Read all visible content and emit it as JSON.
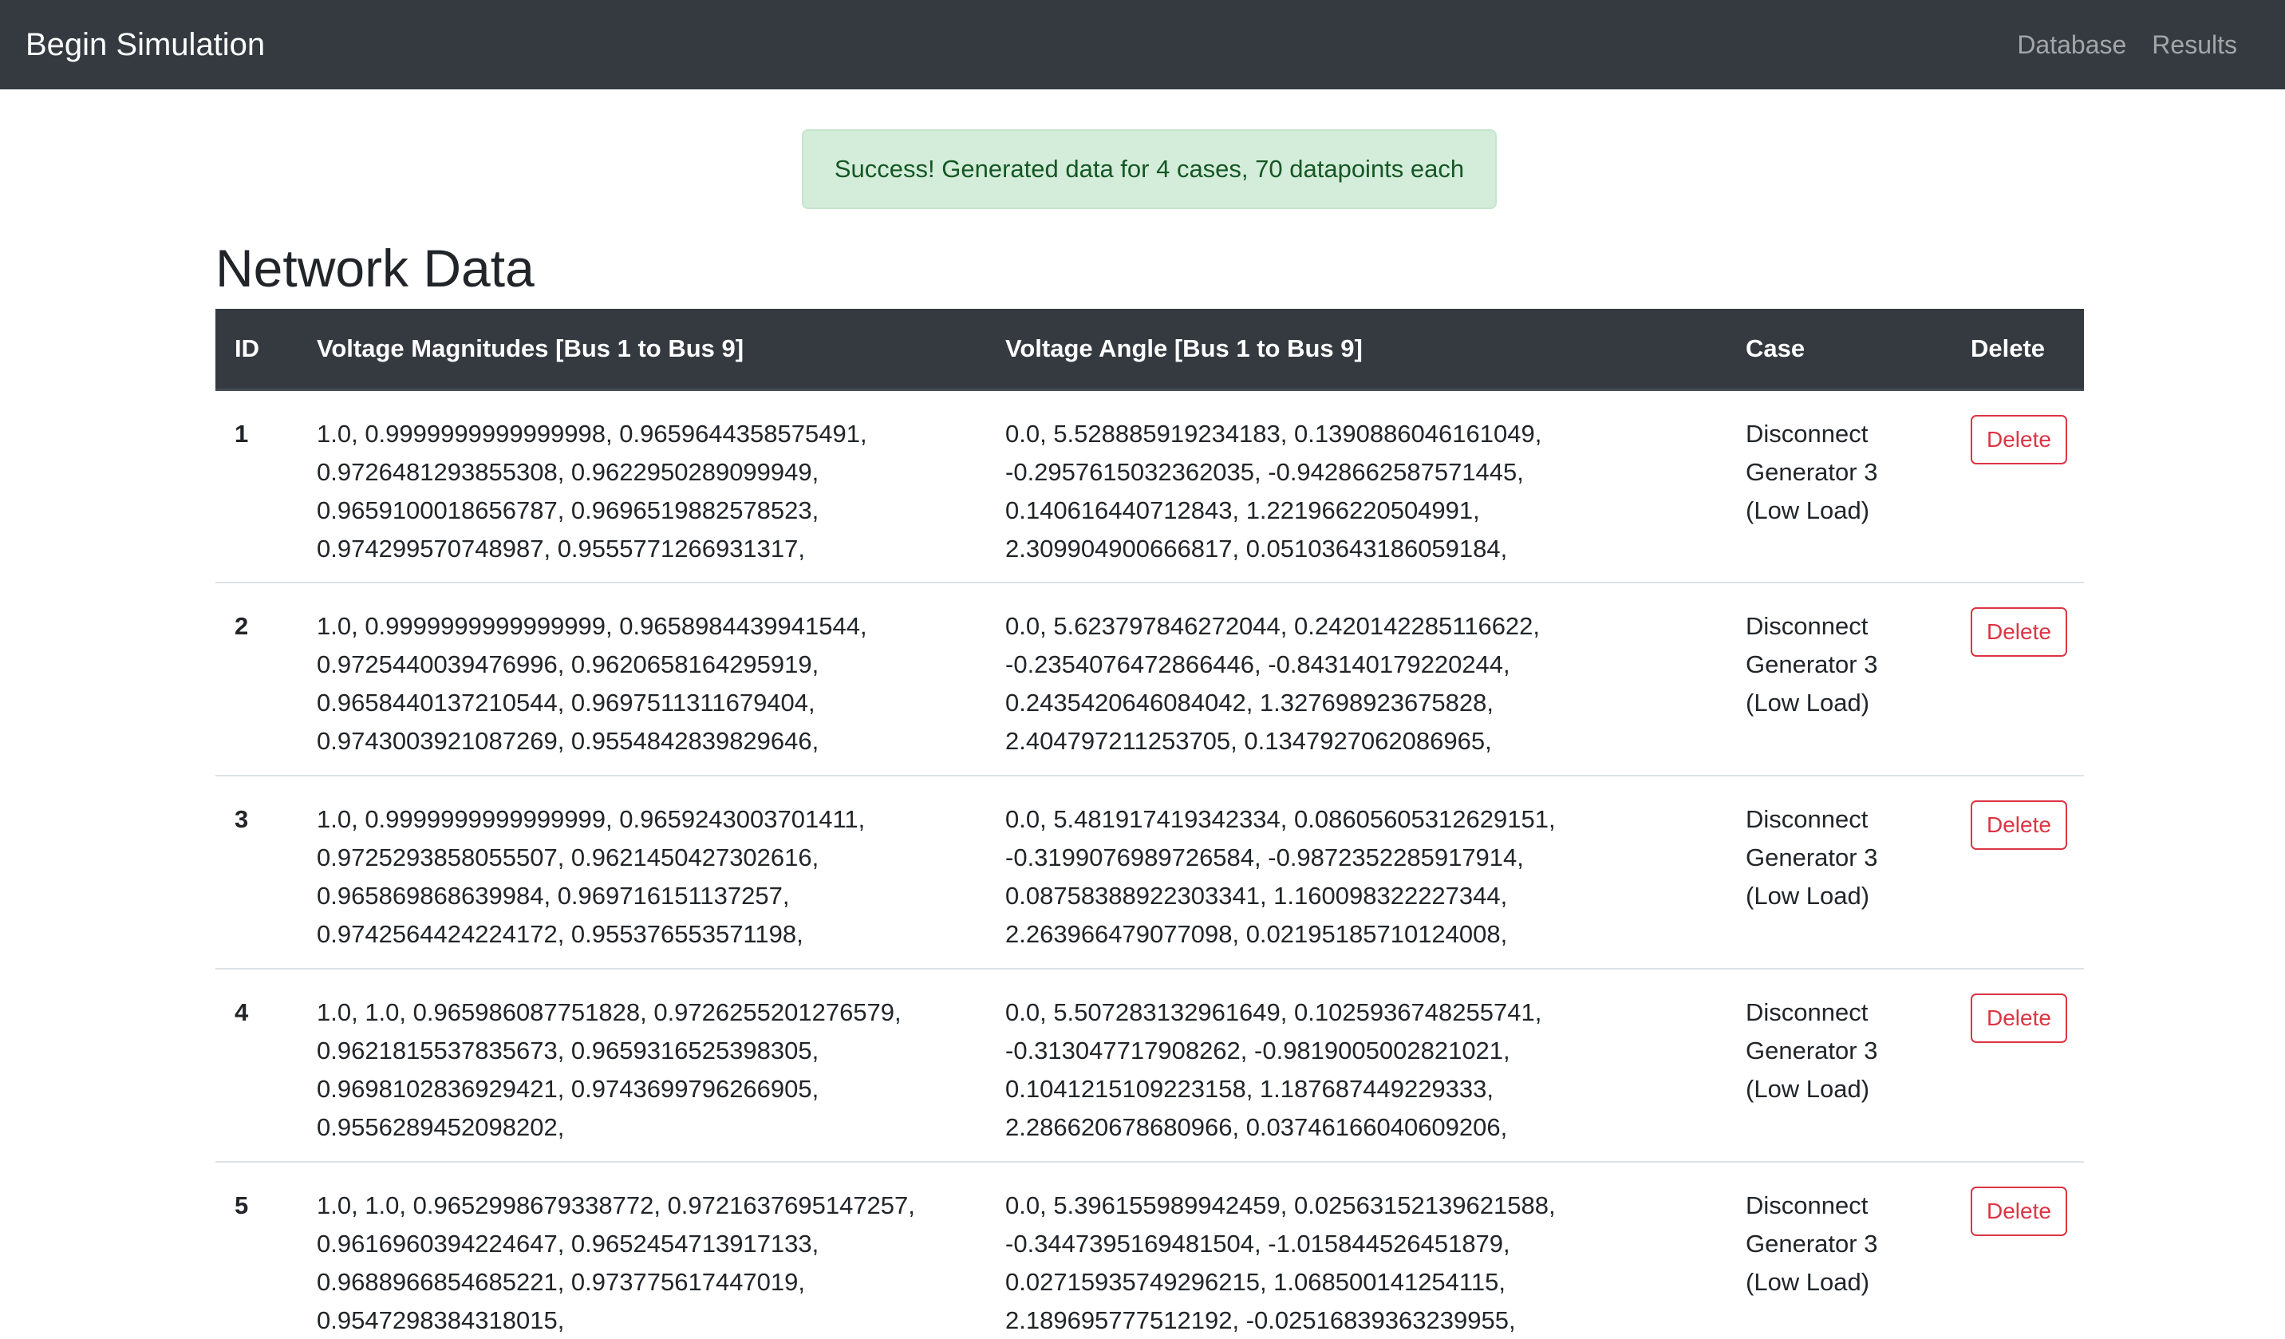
{
  "navbar": {
    "brand": "Begin Simulation",
    "links": [
      "Database",
      "Results"
    ]
  },
  "alert": {
    "message": "Success! Generated data for 4 cases, 70 datapoints each"
  },
  "page_title": "Network Data",
  "table": {
    "headers": [
      "ID",
      "Voltage Magnitudes [Bus 1 to Bus 9]",
      "Voltage Angle [Bus 1 to Bus 9]",
      "Case",
      "Delete"
    ],
    "delete_label": "Delete",
    "rows": [
      {
        "id": "1",
        "magnitudes": "1.0, 0.9999999999999998, 0.9659644358575491, 0.9726481293855308, 0.9622950289099949, 0.9659100018656787, 0.9696519882578523, 0.974299570748987, 0.9555771266931317,",
        "angles": "0.0, 5.528885919234183, 0.1390886046161049, -0.2957615032362035, -0.9428662587571445, 0.140616440712843, 1.221966220504991, 2.309904900666817, 0.05103643186059184,",
        "case": "Disconnect Generator 3 (Low Load)"
      },
      {
        "id": "2",
        "magnitudes": "1.0, 0.9999999999999999, 0.9658984439941544, 0.9725440039476996, 0.9620658164295919, 0.9658440137210544, 0.9697511311679404, 0.9743003921087269, 0.9554842839829646,",
        "angles": "0.0, 5.623797846272044, 0.2420142285116622, -0.2354076472866446, -0.843140179220244, 0.2435420646084042, 1.327698923675828, 2.404797211253705, 0.1347927062086965,",
        "case": "Disconnect Generator 3 (Low Load)"
      },
      {
        "id": "3",
        "magnitudes": "1.0, 0.9999999999999999, 0.9659243003701411, 0.9725293858055507, 0.9621450427302616, 0.965869868639984, 0.969716151137257, 0.9742564424224172, 0.955376553571198,",
        "angles": "0.0, 5.481917419342334, 0.08605605312629151, -0.3199076989726584, -0.9872352285917914, 0.08758388922303341, 1.160098322227344, 2.263966479077098, 0.02195185710124008,",
        "case": "Disconnect Generator 3 (Low Load)"
      },
      {
        "id": "4",
        "magnitudes": "1.0, 1.0, 0.965986087751828, 0.9726255201276579, 0.9621815537835673, 0.9659316525398305, 0.9698102836929421, 0.9743699796266905, 0.9556289452098202,",
        "angles": "0.0, 5.507283132961649, 0.1025936748255741, -0.313047717908262, -0.9819005002821021, 0.1041215109223158, 1.187687449229333, 2.286620678680966, 0.03746166040609206,",
        "case": "Disconnect Generator 3 (Low Load)"
      },
      {
        "id": "5",
        "magnitudes": "1.0, 1.0, 0.9652998679338772, 0.9721637695147257, 0.9616960394224647, 0.9652454713917133, 0.9688966854685221, 0.973775617447019, 0.9547298384318015,",
        "angles": "0.0, 5.396155989942459, 0.02563152139621588, -0.3447395169481504, -1.015844526451879, 0.02715935749296215, 1.068500141254115, 2.189695777512192, -0.02516839363239955,",
        "case": "Disconnect Generator 3 (Low Load)"
      }
    ]
  }
}
